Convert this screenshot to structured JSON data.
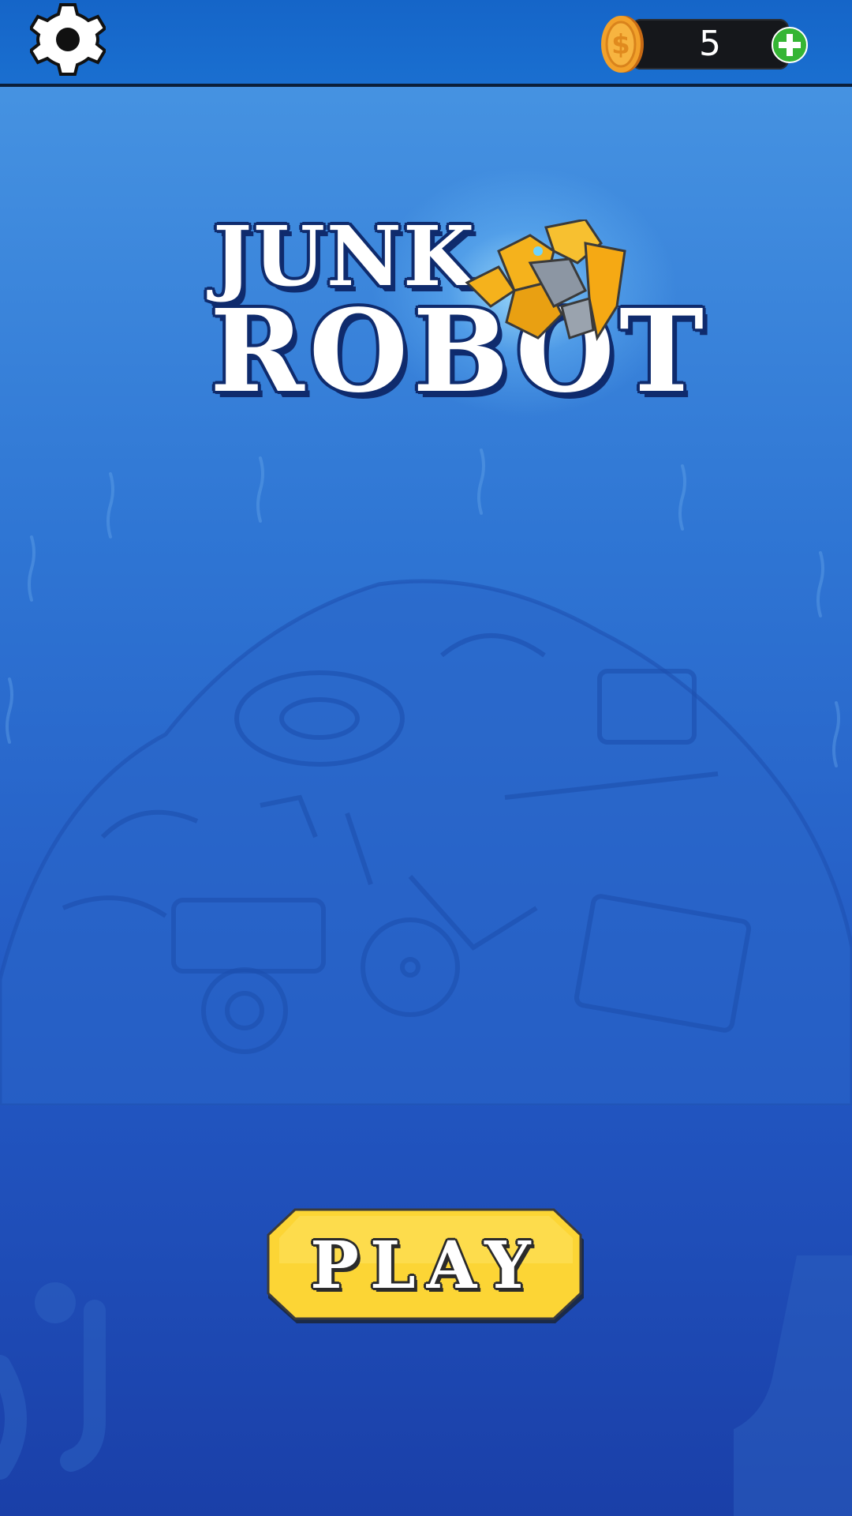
{
  "header": {
    "settings_icon": "gear-icon",
    "coins": {
      "icon": "coin-icon",
      "count": "5",
      "add_icon": "plus-icon"
    }
  },
  "logo": {
    "line1": "JUNK",
    "line2": "ROBOT",
    "mascot": "yellow-robot-illustration"
  },
  "play_button": {
    "label": "PLAY"
  },
  "colors": {
    "background_top": "#4a98e4",
    "background_bottom": "#1a3fa8",
    "topbar": "#1565c8",
    "play_yellow": "#fcd535",
    "plus_green": "#35b534",
    "coin_orange": "#f2a12a"
  }
}
